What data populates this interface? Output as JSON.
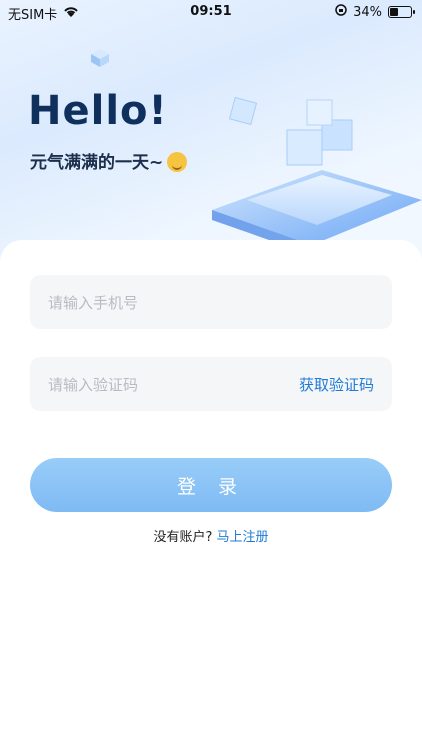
{
  "status_bar": {
    "carrier": "无SIM卡",
    "time": "09:51",
    "battery": "34%"
  },
  "hero": {
    "title": "Hello!",
    "subtitle": "元气满满的一天~"
  },
  "form": {
    "phone_placeholder": "请输入手机号",
    "code_placeholder": "请输入验证码",
    "get_code_label": "获取验证码",
    "login_label": "登 录"
  },
  "footer": {
    "no_account_text": "没有账户?",
    "register_link": "马上注册"
  },
  "colors": {
    "accent": "#1f7bd6",
    "button": "#8cc6f7"
  }
}
